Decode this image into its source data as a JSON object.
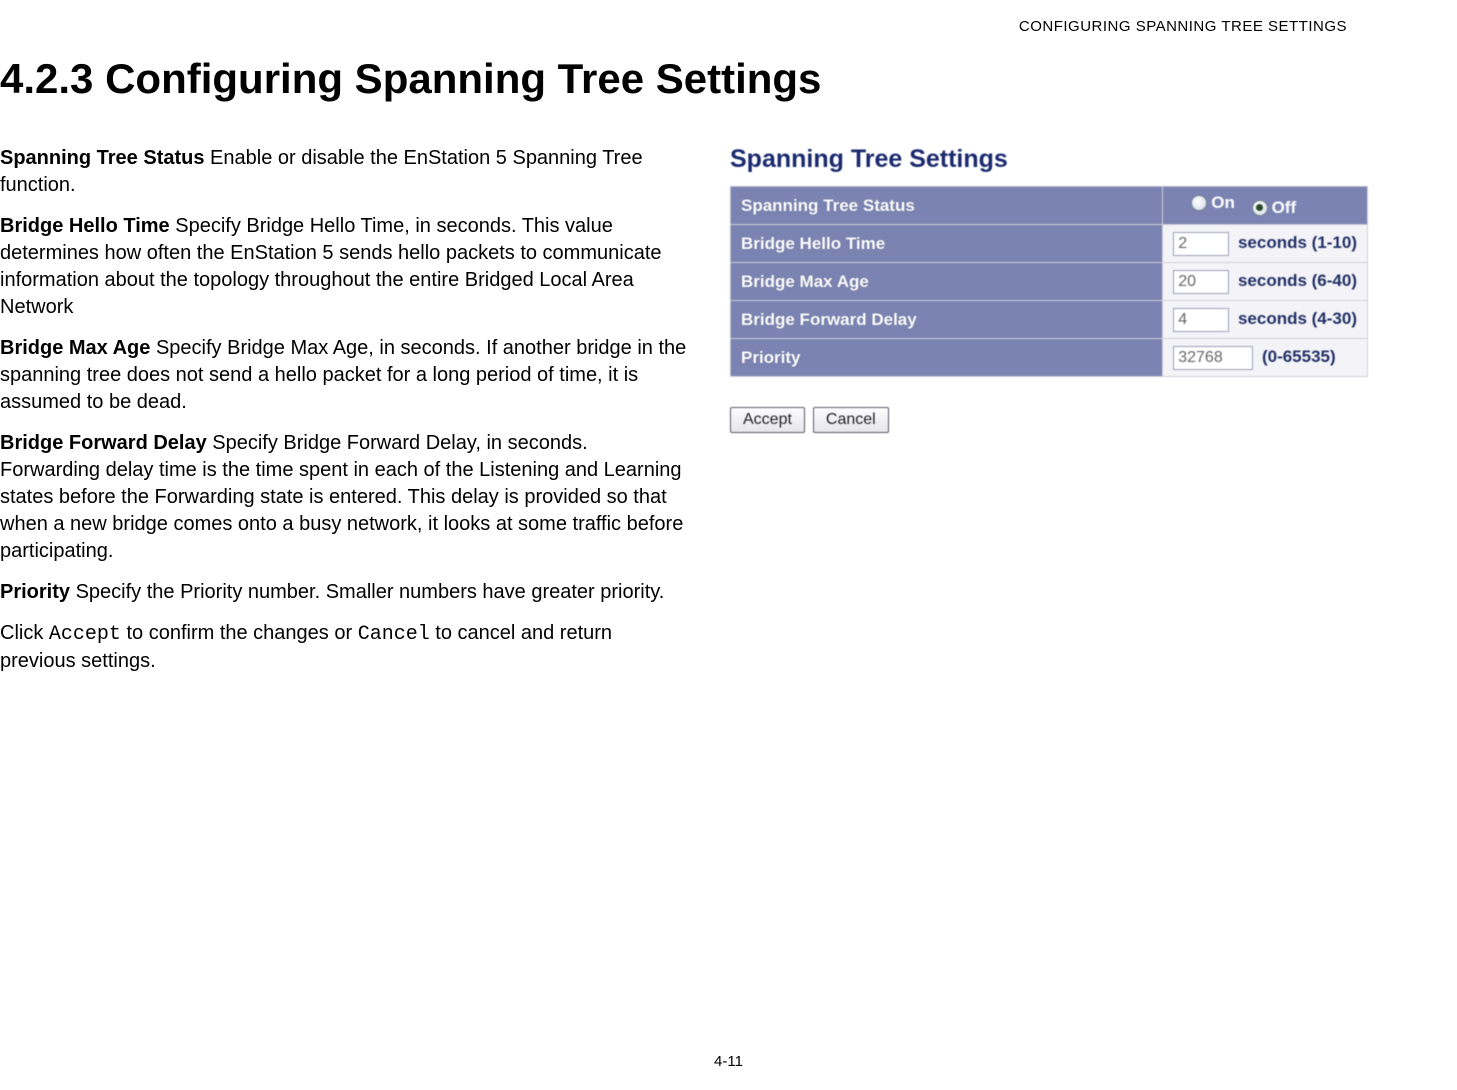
{
  "header": {
    "running_head": "CONFIGURING SPANNING TREE SETTINGS"
  },
  "section": {
    "number_title": "4.2.3 Configuring Spanning Tree Settings"
  },
  "descriptions": {
    "status_label": "Spanning Tree Status",
    "status_text": "  Enable or disable the EnStation 5 Spanning Tree function.",
    "hello_label": "Bridge Hello Time",
    "hello_text": "  Specify Bridge Hello Time, in seconds. This value determines how often the EnStation 5 sends hello packets to communicate information about the topology throughout the entire Bridged Local Area Network",
    "maxage_label": "Bridge Max Age",
    "maxage_text": "  Specify Bridge Max Age, in seconds. If another bridge in the spanning tree does not send a hello packet for a long period of time, it is assumed to be dead.",
    "fwd_label": "Bridge Forward Delay",
    "fwd_text": "  Specify Bridge Forward Delay, in seconds. Forwarding delay time is the time spent in each of the Listening and Learning states before the Forwarding state is entered. This delay is provided so that when a new bridge comes onto a busy network, it looks at some traffic before participating.",
    "priority_label": "Priority",
    "priority_text": "  Specify the Priority number. Smaller numbers have greater priority.",
    "closing_pre": "Click ",
    "closing_accept": "Accept",
    "closing_mid": " to confirm the changes or ",
    "closing_cancel": "Cancel",
    "closing_post": " to cancel and return previous settings."
  },
  "panel": {
    "title": "Spanning Tree Settings",
    "rows": {
      "status": {
        "label": "Spanning Tree Status",
        "on": "On",
        "off": "Off"
      },
      "hello": {
        "label": "Bridge Hello Time",
        "value": "2",
        "unit": "seconds (1-10)"
      },
      "maxage": {
        "label": "Bridge Max Age",
        "value": "20",
        "unit": "seconds (6-40)"
      },
      "fwd": {
        "label": "Bridge Forward Delay",
        "value": "4",
        "unit": "seconds (4-30)"
      },
      "priority": {
        "label": "Priority",
        "value": "32768",
        "unit": "(0-65535)"
      }
    },
    "buttons": {
      "accept": "Accept",
      "cancel": "Cancel"
    }
  },
  "footer": {
    "page_number": "4-11"
  }
}
